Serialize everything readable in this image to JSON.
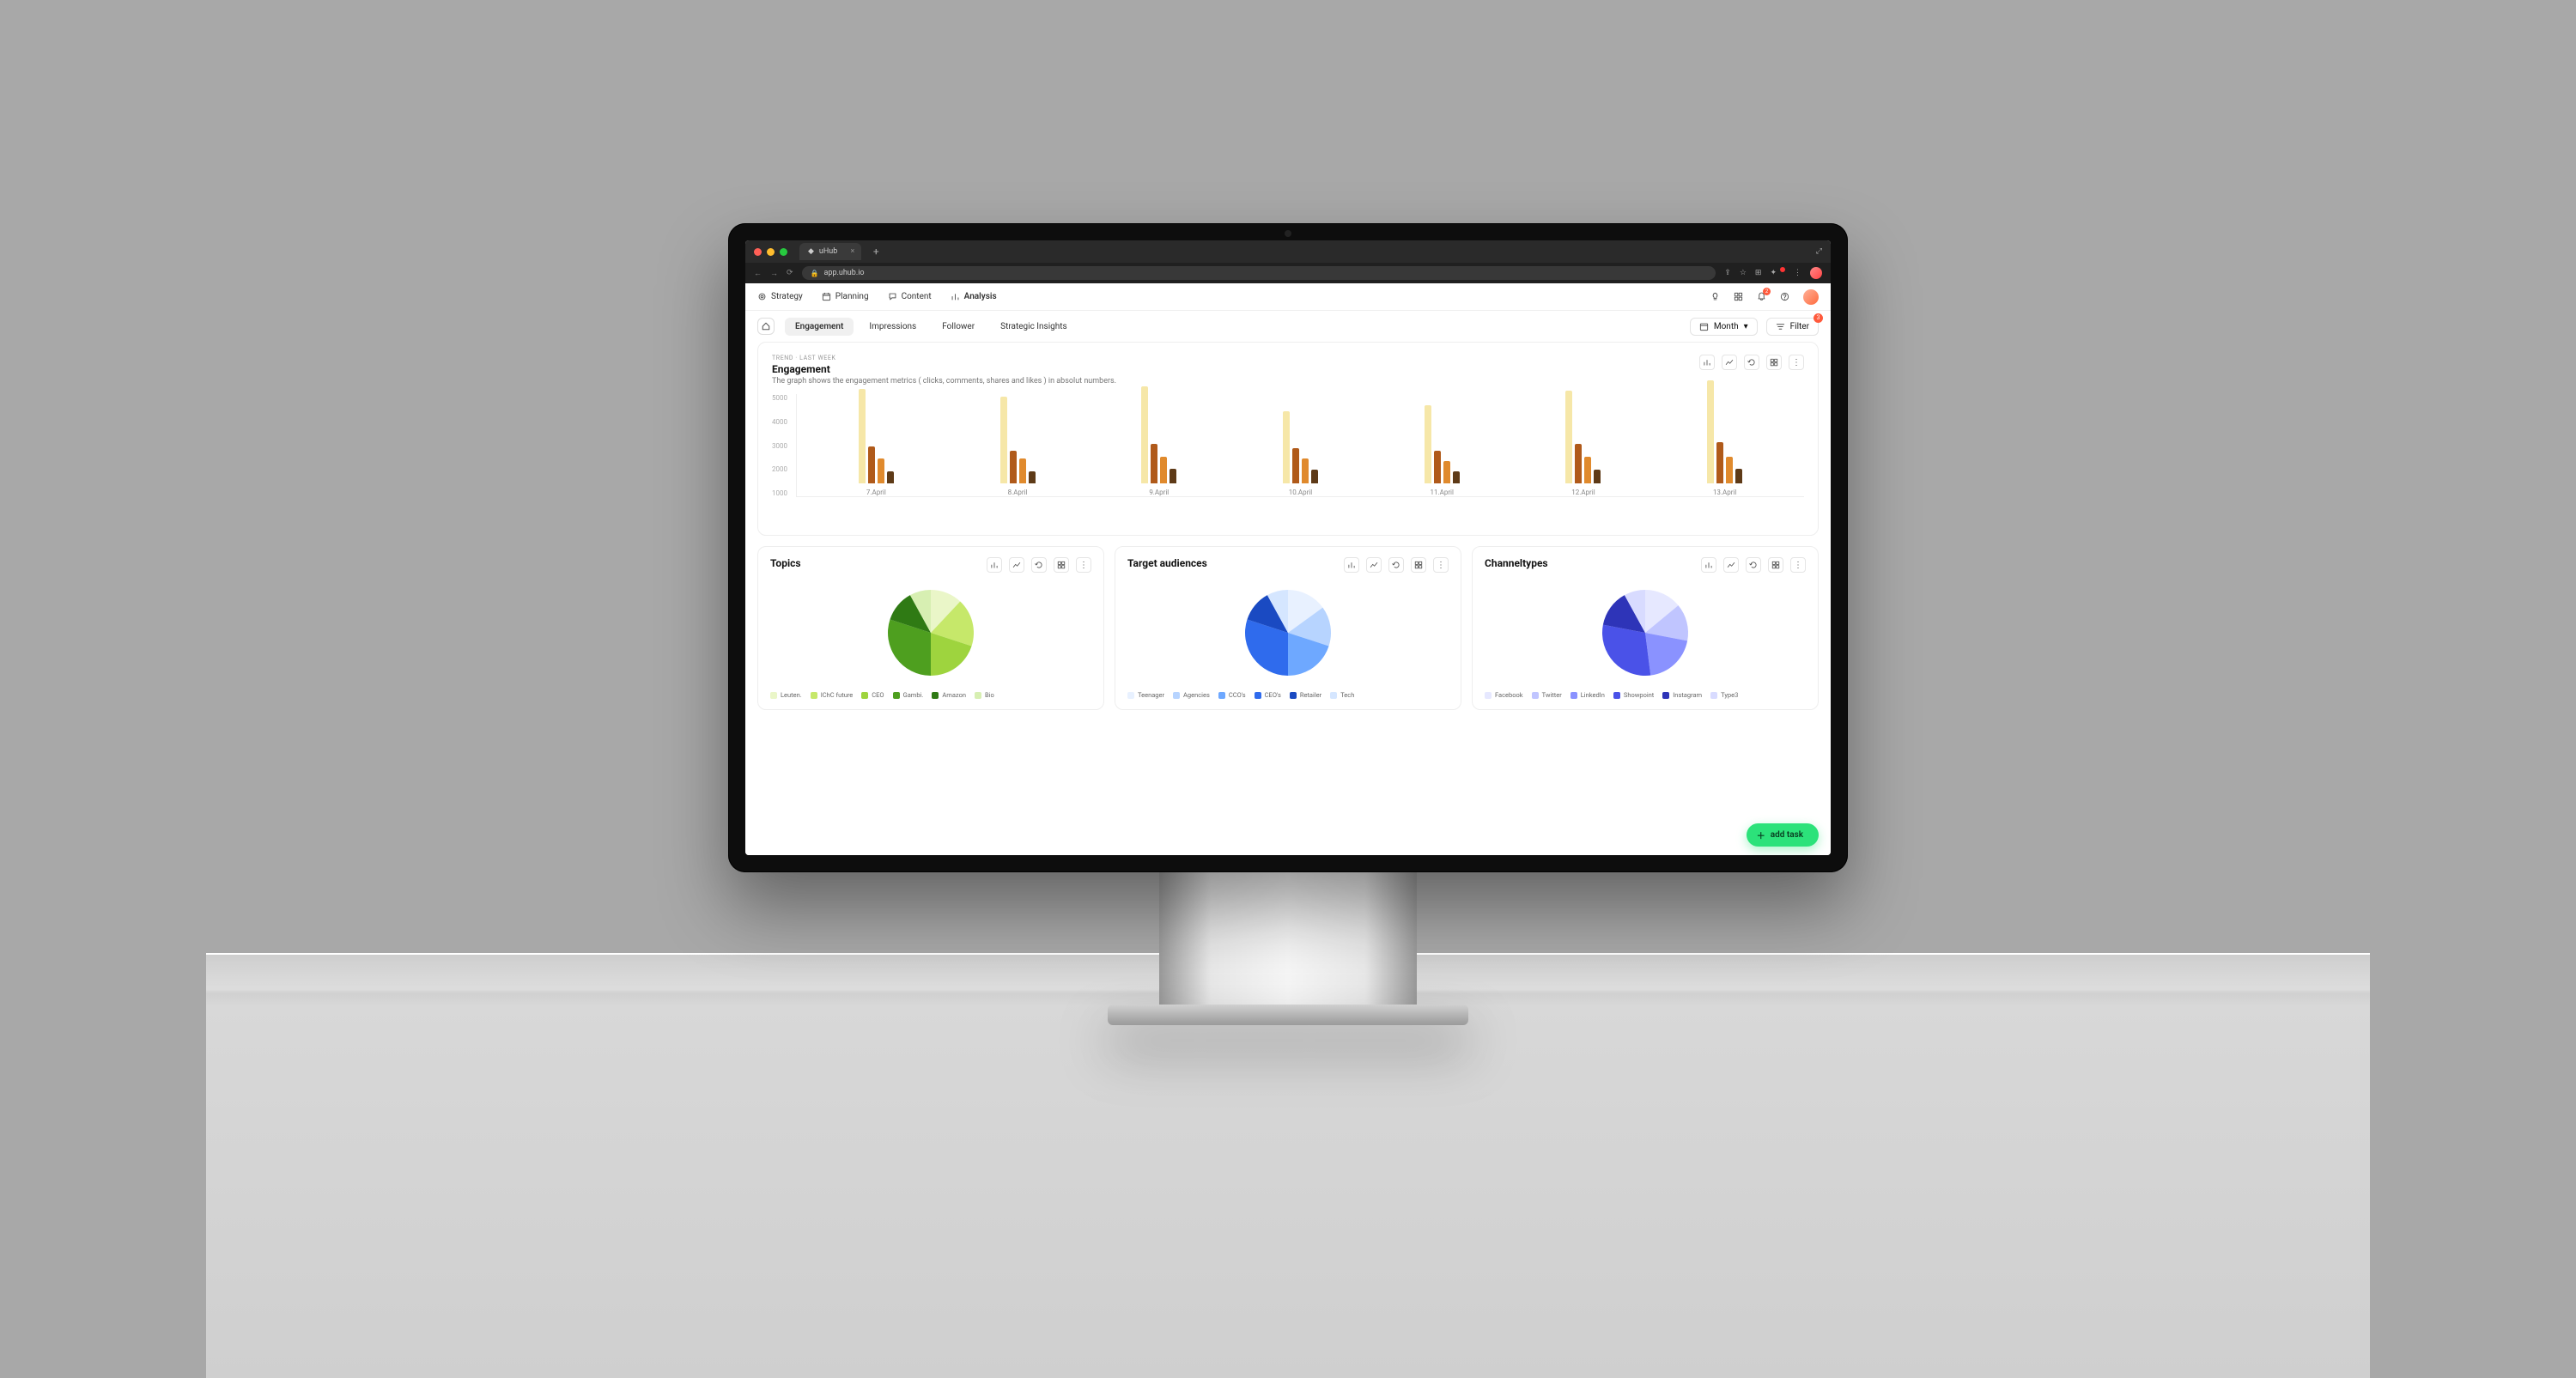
{
  "browser": {
    "tab_title": "uHub",
    "url": "app.uhub.io"
  },
  "nav": {
    "items": [
      {
        "label": "Strategy"
      },
      {
        "label": "Planning"
      },
      {
        "label": "Content"
      },
      {
        "label": "Analysis",
        "active": true
      }
    ],
    "notif_count": "2"
  },
  "subnav": {
    "tabs": [
      {
        "label": "Engagement",
        "active": true
      },
      {
        "label": "Impressions"
      },
      {
        "label": "Follower"
      },
      {
        "label": "Strategic Insights"
      }
    ],
    "period": "Month",
    "filter_label": "Filter",
    "filter_count": "3"
  },
  "engagement_card": {
    "kicker": "TREND · LAST WEEK",
    "title": "Engagement",
    "subtitle": "The graph shows the engagement metrics ( clicks, comments, shares and likes ) in absolut numbers."
  },
  "chart_data": {
    "type": "bar",
    "ylabel": "",
    "ylim": [
      0,
      5000
    ],
    "yticks": [
      "5000",
      "4000",
      "3000",
      "2000",
      "1000"
    ],
    "categories": [
      "7.April",
      "8.April",
      "9.April",
      "10.April",
      "11.April",
      "12.April",
      "13.April"
    ],
    "series": [
      {
        "name": "clicks",
        "color": "#f6e7a8",
        "values": [
          4600,
          4200,
          4700,
          3500,
          3800,
          4500,
          5000
        ]
      },
      {
        "name": "comments",
        "color": "#b05a1a",
        "values": [
          1800,
          1600,
          1900,
          1700,
          1600,
          1900,
          2000
        ]
      },
      {
        "name": "shares",
        "color": "#e08a2d",
        "values": [
          1200,
          1200,
          1300,
          1200,
          1100,
          1300,
          1300
        ]
      },
      {
        "name": "likes",
        "color": "#5e3a17",
        "values": [
          600,
          600,
          700,
          650,
          600,
          650,
          700
        ]
      }
    ]
  },
  "pies": [
    {
      "title": "Topics",
      "legend": [
        "Leuten.",
        "IChC future",
        "CEO",
        "Gambi.",
        "Amazon",
        "Bio"
      ],
      "chart_data": {
        "type": "pie",
        "slices": [
          {
            "label": "Leuten.",
            "value": 12,
            "color": "#eaf6c8"
          },
          {
            "label": "IChC future",
            "value": 18,
            "color": "#c6e86a"
          },
          {
            "label": "CEO",
            "value": 20,
            "color": "#9ed43e"
          },
          {
            "label": "Gambi.",
            "value": 30,
            "color": "#4e9f1f"
          },
          {
            "label": "Amazon",
            "value": 12,
            "color": "#2f7a14"
          },
          {
            "label": "Bio",
            "value": 8,
            "color": "#d7efb2"
          }
        ]
      }
    },
    {
      "title": "Target audiences",
      "legend": [
        "Teenager",
        "Agencies",
        "CCO's",
        "CEO's",
        "Retailer",
        "Tech"
      ],
      "chart_data": {
        "type": "pie",
        "slices": [
          {
            "label": "Teenager",
            "value": 15,
            "color": "#e8f1ff"
          },
          {
            "label": "Agencies",
            "value": 15,
            "color": "#b7d4ff"
          },
          {
            "label": "CCO's",
            "value": 20,
            "color": "#6ea8ff"
          },
          {
            "label": "CEO's",
            "value": 30,
            "color": "#2f6bed"
          },
          {
            "label": "Retailer",
            "value": 12,
            "color": "#1a4ac2"
          },
          {
            "label": "Tech",
            "value": 8,
            "color": "#d5e6ff"
          }
        ]
      }
    },
    {
      "title": "Channeltypes",
      "legend": [
        "Facebook",
        "Twitter",
        "LinkedIn",
        "Showpoint",
        "Instagram",
        "Type3"
      ],
      "chart_data": {
        "type": "pie",
        "slices": [
          {
            "label": "Facebook",
            "value": 14,
            "color": "#e6e8ff"
          },
          {
            "label": "Twitter",
            "value": 14,
            "color": "#c0c5ff"
          },
          {
            "label": "LinkedIn",
            "value": 20,
            "color": "#8a92ff"
          },
          {
            "label": "Showpoint",
            "value": 30,
            "color": "#4a52e8"
          },
          {
            "label": "Instagram",
            "value": 14,
            "color": "#2e34b8"
          },
          {
            "label": "Type3",
            "value": 8,
            "color": "#d8dbff"
          }
        ]
      }
    }
  ],
  "fab": {
    "label": "add task"
  }
}
